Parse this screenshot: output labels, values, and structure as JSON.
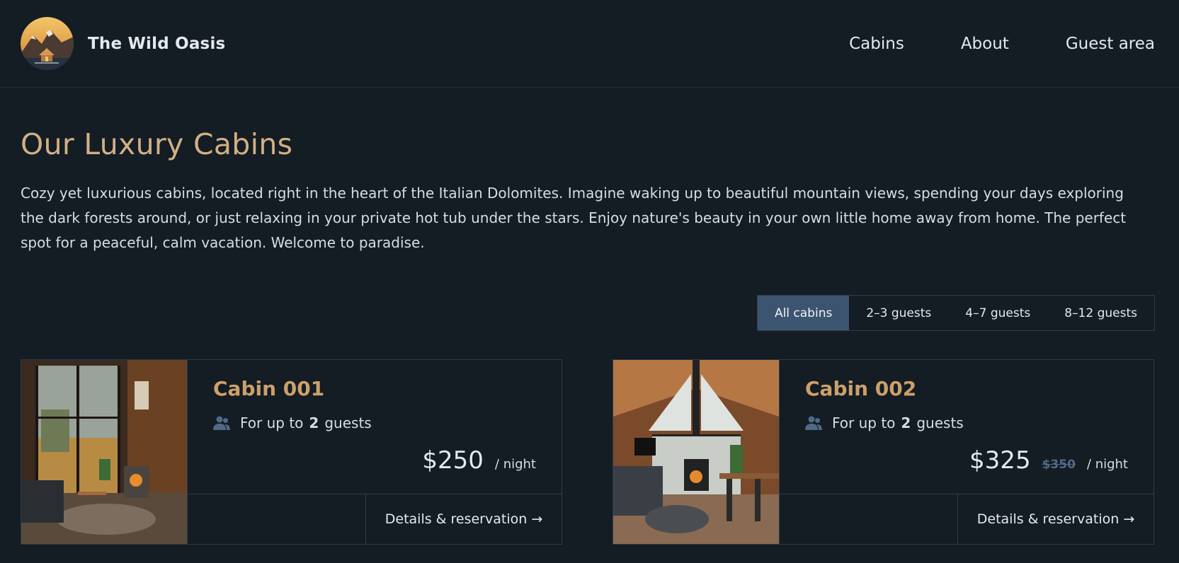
{
  "header": {
    "brand_name": "The Wild Oasis",
    "logo_icon": "mountain-cabin-logo",
    "nav": [
      {
        "label": "Cabins"
      },
      {
        "label": "About"
      },
      {
        "label": "Guest area"
      }
    ]
  },
  "main": {
    "title": "Our Luxury Cabins",
    "intro": "Cozy yet luxurious cabins, located right in the heart of the Italian Dolomites. Imagine waking up to beautiful mountain views, spending your days exploring the dark forests around, or just relaxing in your private hot tub under the stars. Enjoy nature's beauty in your own little home away from home. The perfect spot for a peaceful, calm vacation. Welcome to paradise.",
    "filters": [
      {
        "label": "All cabins",
        "active": true
      },
      {
        "label": "2–3 guests",
        "active": false
      },
      {
        "label": "4–7 guests",
        "active": false
      },
      {
        "label": "8–12 guests",
        "active": false
      }
    ],
    "cabins": [
      {
        "name": "Cabin 001",
        "guests_prefix": "For up to",
        "guests_count": "2",
        "guests_suffix": "guests",
        "price": "$250",
        "old_price": "",
        "per_night": "/ night",
        "link": "Details & reservation →"
      },
      {
        "name": "Cabin 002",
        "guests_prefix": "For up to",
        "guests_count": "2",
        "guests_suffix": "guests",
        "price": "$325",
        "old_price": "$350",
        "per_night": "/ night",
        "link": "Details & reservation →"
      }
    ]
  },
  "colors": {
    "background": "#141c24",
    "accent": "#d2af84",
    "cabin_name": "#cda06b",
    "active_filter": "#3c5470",
    "border": "#2c3d4f",
    "old_price": "#4f6a85"
  }
}
